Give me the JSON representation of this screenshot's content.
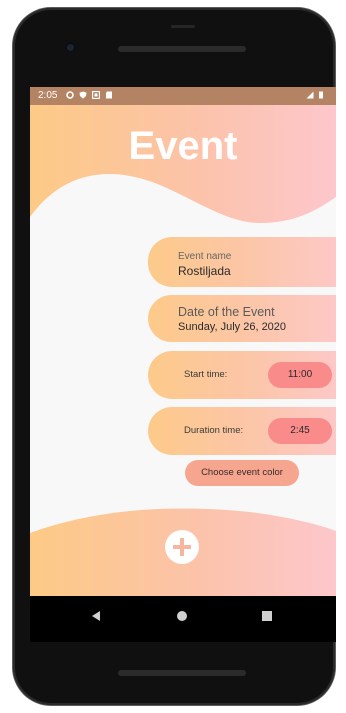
{
  "status_bar": {
    "time": "2:05"
  },
  "header": {
    "title": "Event"
  },
  "form": {
    "event_name": {
      "label": "Event name",
      "value": "Rostiljada"
    },
    "date": {
      "label": "Date of the Event",
      "value": "Sunday, July 26, 2020"
    },
    "start_time": {
      "label": "Start time:",
      "value": "11:00"
    },
    "duration_time": {
      "label": "Duration time:",
      "value": "2:45"
    },
    "color_button": {
      "label": "Choose event color"
    }
  },
  "footer": {
    "add_icon": "plus-icon"
  },
  "colors": {
    "gradient_start": "#fdca8a",
    "gradient_end": "#fdc8c7",
    "pill": "#f98c8a",
    "color_button": "#f6a68f",
    "status_bar": "#b48363"
  }
}
